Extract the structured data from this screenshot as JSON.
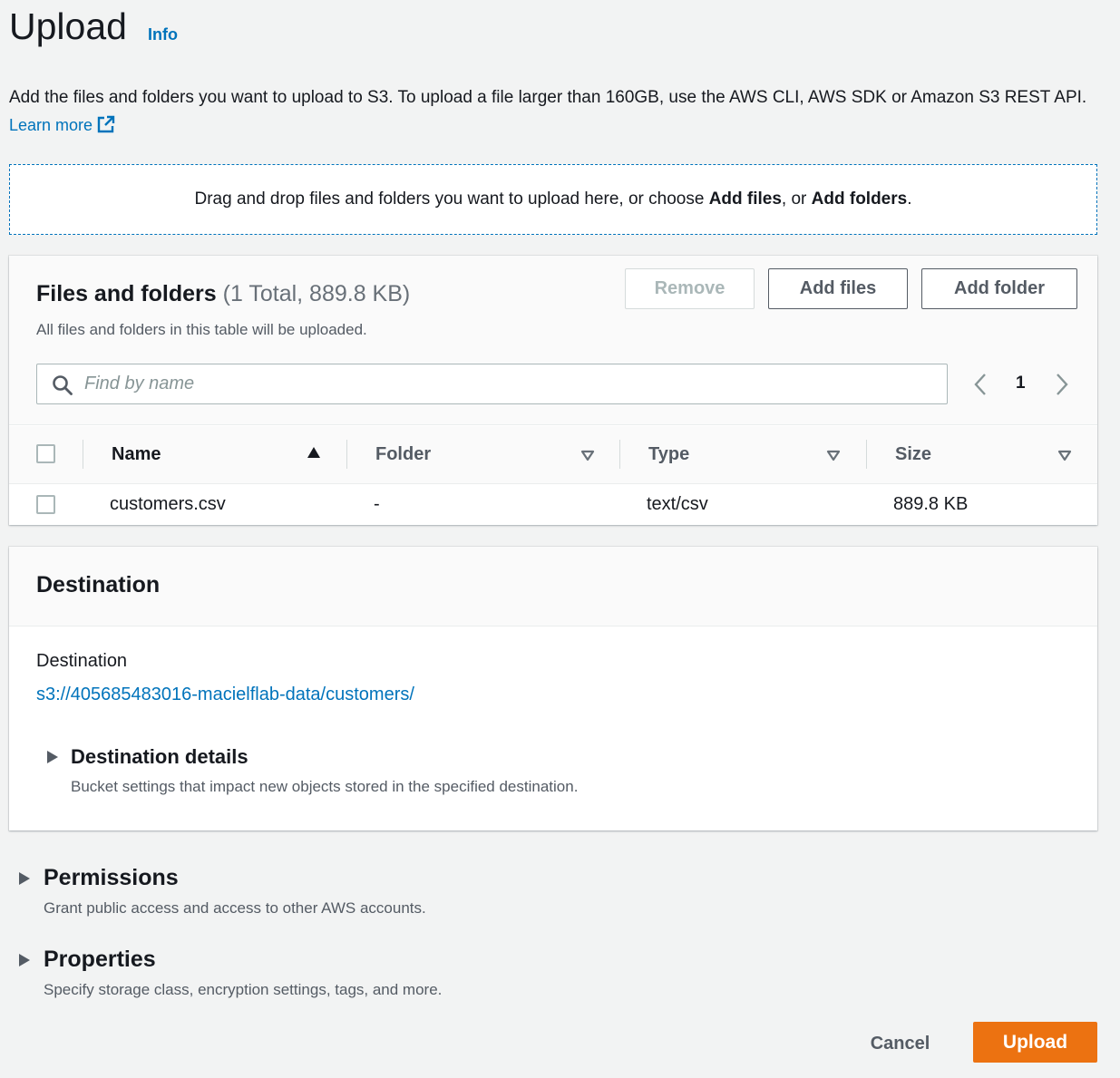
{
  "header": {
    "title": "Upload",
    "info_label": "Info",
    "intro_text": "Add the files and folders you want to upload to S3. To upload a file larger than 160GB, use the AWS CLI, AWS SDK or Amazon S3 REST API.",
    "learn_more_label": "Learn more"
  },
  "dropzone": {
    "text_before": "Drag and drop files and folders you want to upload here, or choose ",
    "add_files": "Add files",
    "separator": ", or ",
    "add_folders": "Add folders",
    "text_after": "."
  },
  "files_panel": {
    "title": "Files and folders",
    "count": "(1 Total, 889.8 KB)",
    "subtitle": "All files and folders in this table will be uploaded.",
    "remove_label": "Remove",
    "add_files_label": "Add files",
    "add_folder_label": "Add folder",
    "search_placeholder": "Find by name",
    "page_number": "1",
    "columns": [
      "Name",
      "Folder",
      "Type",
      "Size"
    ],
    "rows": [
      {
        "name": "customers.csv",
        "folder": "-",
        "type": "text/csv",
        "size": "889.8 KB"
      }
    ]
  },
  "destination": {
    "section_title": "Destination",
    "label": "Destination",
    "path": "s3://405685483016-macielflab-data/customers/",
    "details_title": "Destination details",
    "details_sub": "Bucket settings that impact new objects stored in the specified destination."
  },
  "permissions": {
    "title": "Permissions",
    "sub": "Grant public access and access to other AWS accounts."
  },
  "properties": {
    "title": "Properties",
    "sub": "Specify storage class, encryption settings, tags, and more."
  },
  "footer": {
    "cancel_label": "Cancel",
    "upload_label": "Upload"
  },
  "colors": {
    "link": "#0073bb",
    "primary": "#ec7211",
    "background": "#f2f3f3"
  },
  "icons": [
    "external-link-icon",
    "search-icon",
    "chevron-left-icon",
    "chevron-right-icon",
    "sort-ascending-icon",
    "sort-icon",
    "caret-right-icon"
  ]
}
